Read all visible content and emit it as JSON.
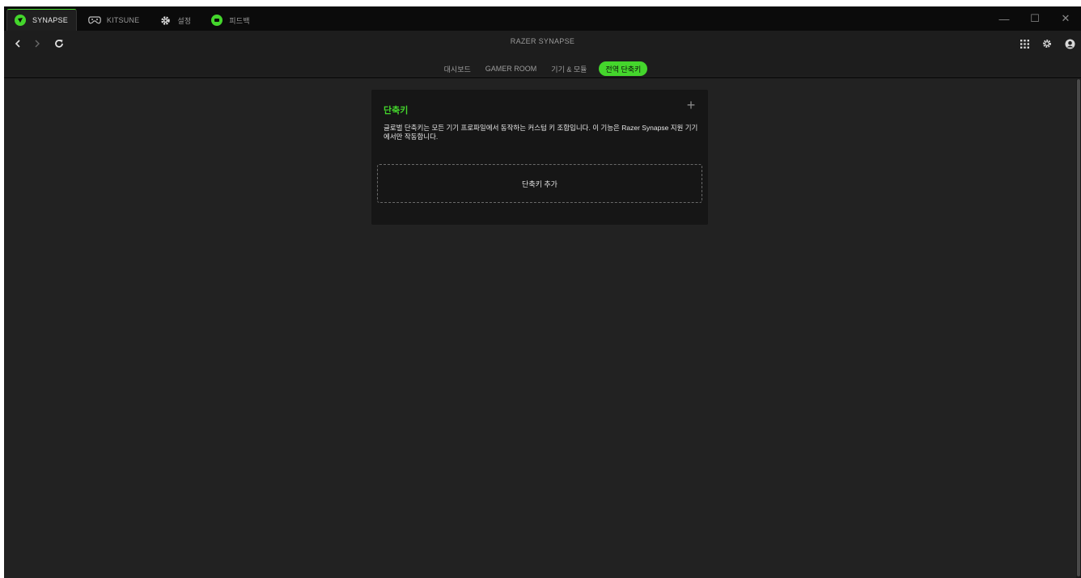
{
  "tabs": [
    {
      "label": "SYNAPSE",
      "icon": "synapse-icon",
      "active": true
    },
    {
      "label": "KITSUNE",
      "icon": "gamepad-icon",
      "active": false
    },
    {
      "label": "설정",
      "icon": "gear-icon",
      "active": false
    },
    {
      "label": "피드백",
      "icon": "chat-icon",
      "active": false
    }
  ],
  "window_controls": {
    "minimize": "—",
    "maximize": "☐",
    "close": "✕"
  },
  "app_title": "RAZER SYNAPSE",
  "subnav": [
    {
      "label": "대시보드",
      "active": false
    },
    {
      "label": "GAMER ROOM",
      "active": false
    },
    {
      "label": "기기 & 모듈",
      "active": false
    },
    {
      "label": "전역 단축키",
      "active": true
    }
  ],
  "card": {
    "title": "단축키",
    "add_symbol": "+",
    "description": "글로벌 단축키는 모든 기기 프로파일에서 동작하는 커스텀 키 조합입니다. 이 기능은 Razer Synapse 지원 기기에서만 작동합니다.",
    "add_shortcut_label": "단축키 추가"
  },
  "colors": {
    "accent": "#44d62c",
    "background": "#222222",
    "card": "#161616"
  }
}
